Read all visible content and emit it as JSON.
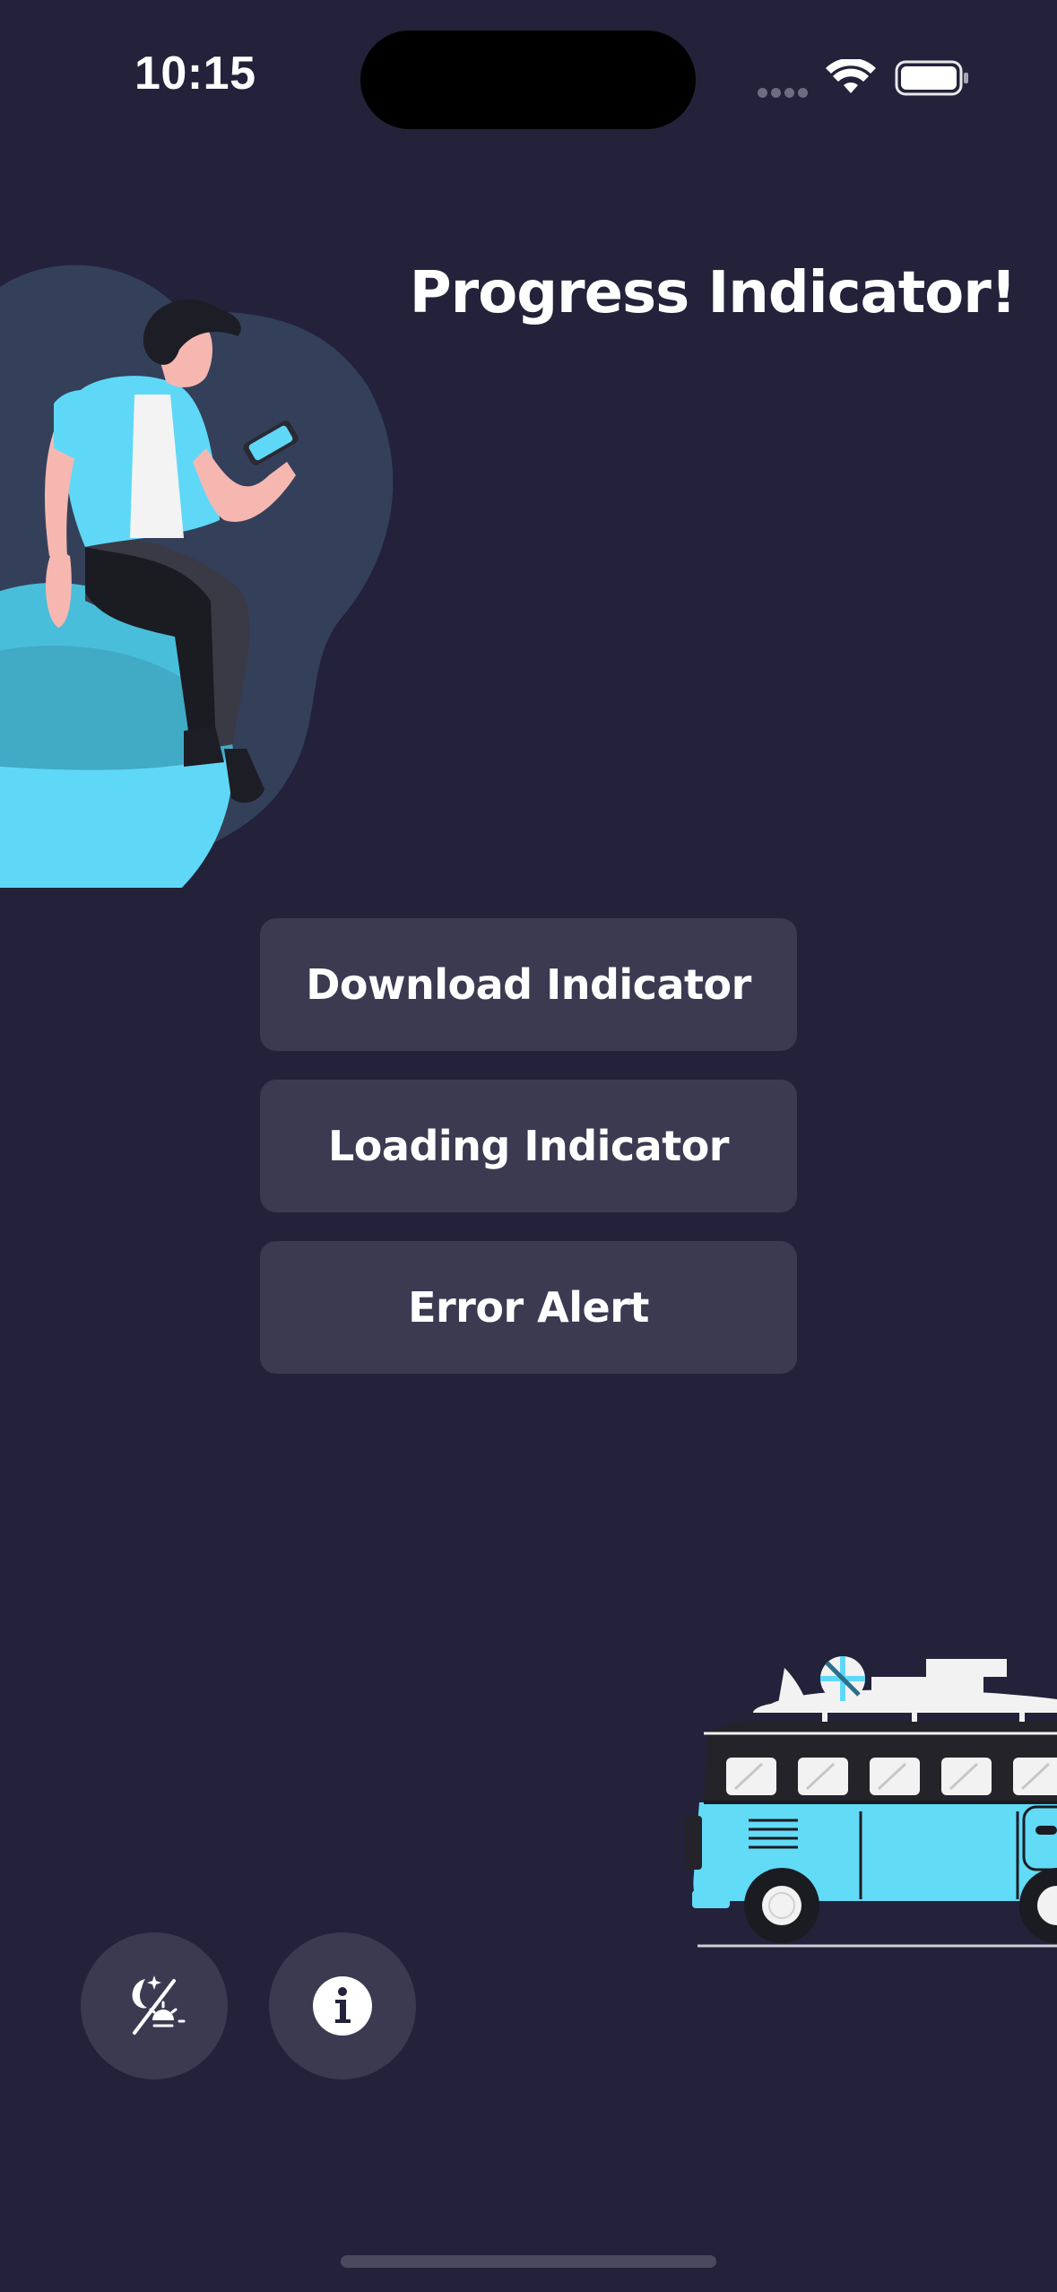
{
  "status_bar": {
    "time": "10:15",
    "icons": [
      "signal-dots-icon",
      "wifi-icon",
      "battery-icon"
    ]
  },
  "title": "Progress Indicator!",
  "buttons": {
    "download": "Download Indicator",
    "loading": "Loading Indicator",
    "error": "Error Alert"
  },
  "bottom_actions": {
    "theme_icon": "theme-toggle-icon",
    "info_icon": "info-icon"
  },
  "colors": {
    "background": "#23223a",
    "button": "#3b3a51",
    "accent": "#62d9f7",
    "text": "#ffffff"
  }
}
